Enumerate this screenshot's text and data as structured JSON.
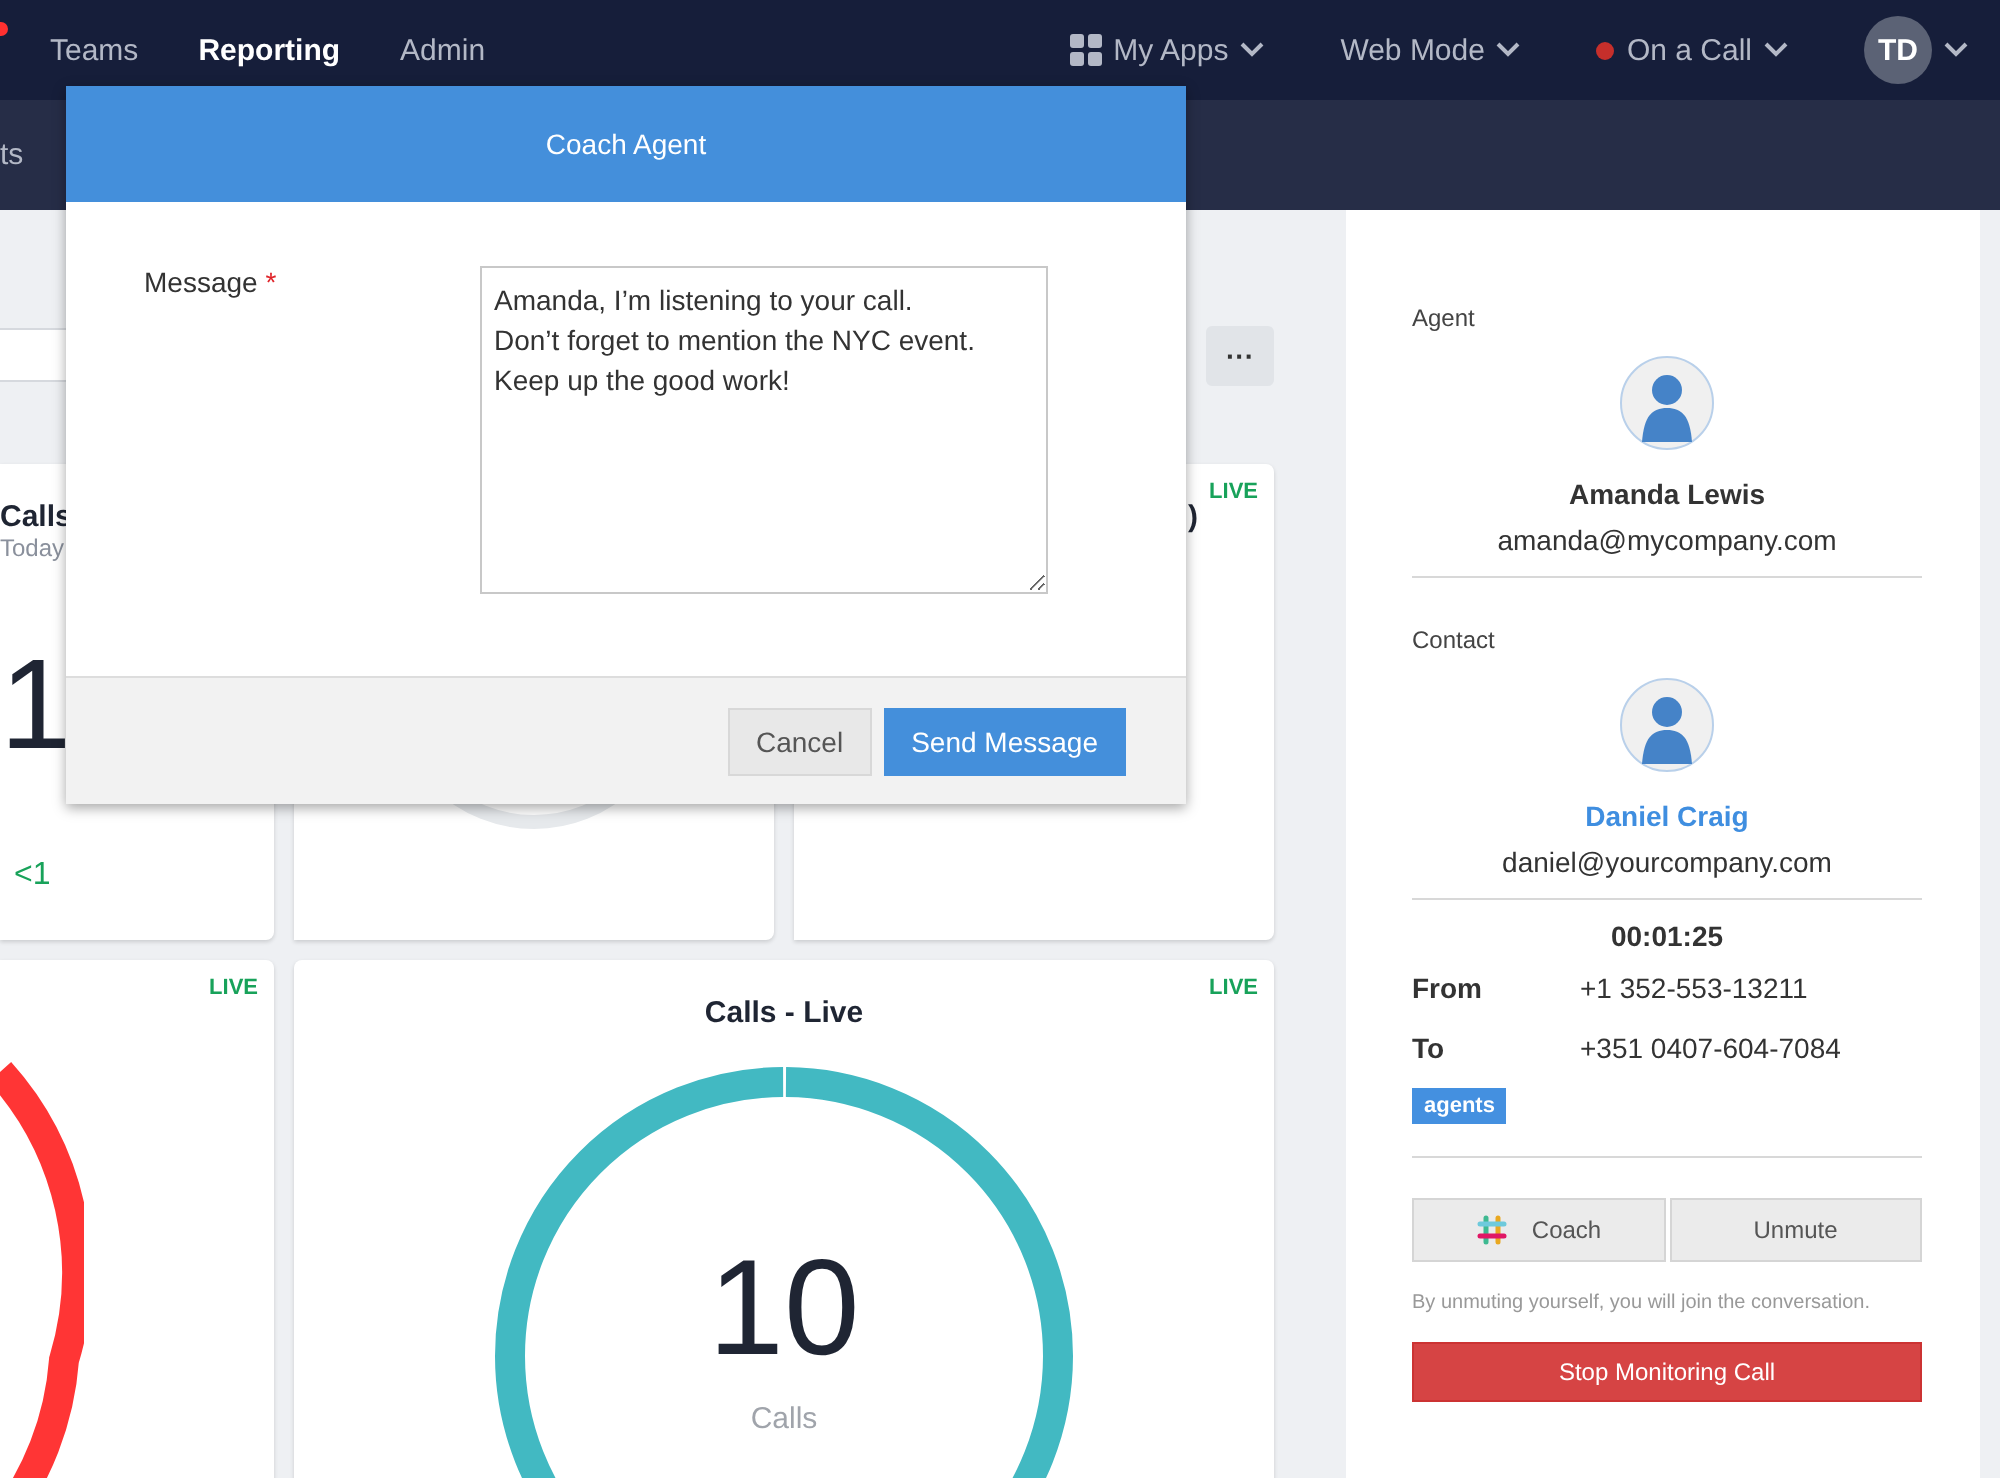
{
  "nav": {
    "items": [
      {
        "label": "Teams",
        "selected": false
      },
      {
        "label": "Reporting",
        "selected": true
      },
      {
        "label": "Admin",
        "selected": false
      }
    ],
    "apps": "My Apps",
    "mode": "Web Mode",
    "status": {
      "label": "On a Call",
      "color": "#c62f2b"
    },
    "avatar": "TD"
  },
  "subnav": {
    "fragment": "ts"
  },
  "dashboard": {
    "more": "···",
    "cards": [
      {
        "kind": "stat",
        "title": "Calls",
        "subtitle": "Today",
        "value": "1",
        "delta": "<1"
      },
      {
        "kind": "gauge"
      },
      {
        "kind": "stat",
        "title": ")",
        "badge": "LIVE"
      },
      {
        "kind": "ring",
        "badge": "LIVE",
        "color": "#ff3535"
      },
      {
        "kind": "ring",
        "title": "Calls - Live",
        "badge": "LIVE",
        "value": "10",
        "unit": "Calls",
        "color": "#42b9c2"
      }
    ]
  },
  "dialog": {
    "title": "Coach Agent",
    "label": "Message",
    "required_mark": "*",
    "value": "Amanda, I’m listening to your call.\nDon’t forget to mention the NYC event.\nKeep up the good work!",
    "buttons": [
      {
        "label": "Cancel",
        "kind": "secondary"
      },
      {
        "label": "Send Message",
        "kind": "primary"
      }
    ]
  },
  "call_panel": {
    "people": [
      {
        "role": "Agent",
        "name": "Amanda Lewis",
        "email": "amanda@mycompany.com",
        "link": false
      },
      {
        "role": "Contact",
        "name": "Daniel Craig",
        "email": "daniel@yourcompany.com",
        "link": true
      }
    ],
    "timer": "00:01:25",
    "rows": [
      {
        "label": "From",
        "value": "+1 352-553-13211"
      },
      {
        "label": "To",
        "value": "+351 0407-604-7084"
      }
    ],
    "tag": "agents",
    "actions": [
      {
        "label": "Coach",
        "kind": "coach"
      },
      {
        "label": "Unmute",
        "kind": "plain"
      }
    ],
    "note": "By unmuting yourself, you will join the conversation.",
    "stop": "Stop Monitoring Call"
  }
}
